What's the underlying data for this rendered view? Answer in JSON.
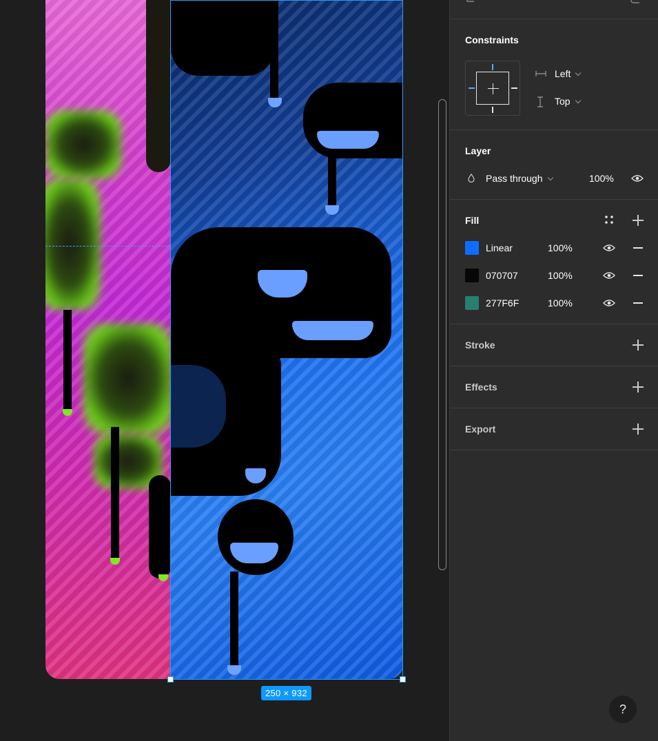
{
  "canvas": {
    "frame_size_label": "250 × 932"
  },
  "panel": {
    "constraints": {
      "title": "Constraints",
      "horizontal": "Left",
      "vertical": "Top"
    },
    "layer": {
      "title": "Layer",
      "blend_mode": "Pass through",
      "opacity": "100%"
    },
    "fill": {
      "title": "Fill",
      "items": [
        {
          "label": "Linear",
          "opacity": "100%",
          "color": "#0d6efd"
        },
        {
          "label": "070707",
          "opacity": "100%",
          "color": "#070707"
        },
        {
          "label": "277F6F",
          "opacity": "100%",
          "color": "#277F6F"
        }
      ]
    },
    "stroke": {
      "title": "Stroke"
    },
    "effects": {
      "title": "Effects"
    },
    "export": {
      "title": "Export"
    }
  },
  "help": {
    "label": "?"
  },
  "icons": {
    "visibility": "eye-icon",
    "styles": "style-dots-icon",
    "add": "plus-icon",
    "remove": "minus-icon",
    "blend": "drop-icon"
  }
}
